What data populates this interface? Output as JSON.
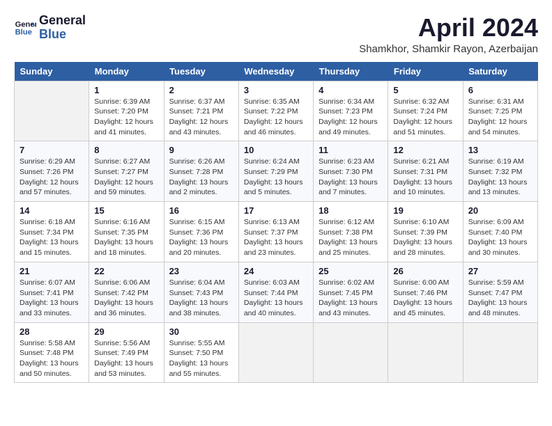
{
  "header": {
    "logo_line1": "General",
    "logo_line2": "Blue",
    "month": "April 2024",
    "location": "Shamkhor, Shamkir Rayon, Azerbaijan"
  },
  "weekdays": [
    "Sunday",
    "Monday",
    "Tuesday",
    "Wednesday",
    "Thursday",
    "Friday",
    "Saturday"
  ],
  "weeks": [
    [
      {
        "day": null
      },
      {
        "day": "1",
        "sunrise": "6:39 AM",
        "sunset": "7:20 PM",
        "daylight": "12 hours and 41 minutes."
      },
      {
        "day": "2",
        "sunrise": "6:37 AM",
        "sunset": "7:21 PM",
        "daylight": "12 hours and 43 minutes."
      },
      {
        "day": "3",
        "sunrise": "6:35 AM",
        "sunset": "7:22 PM",
        "daylight": "12 hours and 46 minutes."
      },
      {
        "day": "4",
        "sunrise": "6:34 AM",
        "sunset": "7:23 PM",
        "daylight": "12 hours and 49 minutes."
      },
      {
        "day": "5",
        "sunrise": "6:32 AM",
        "sunset": "7:24 PM",
        "daylight": "12 hours and 51 minutes."
      },
      {
        "day": "6",
        "sunrise": "6:31 AM",
        "sunset": "7:25 PM",
        "daylight": "12 hours and 54 minutes."
      }
    ],
    [
      {
        "day": "7",
        "sunrise": "6:29 AM",
        "sunset": "7:26 PM",
        "daylight": "12 hours and 57 minutes."
      },
      {
        "day": "8",
        "sunrise": "6:27 AM",
        "sunset": "7:27 PM",
        "daylight": "12 hours and 59 minutes."
      },
      {
        "day": "9",
        "sunrise": "6:26 AM",
        "sunset": "7:28 PM",
        "daylight": "13 hours and 2 minutes."
      },
      {
        "day": "10",
        "sunrise": "6:24 AM",
        "sunset": "7:29 PM",
        "daylight": "13 hours and 5 minutes."
      },
      {
        "day": "11",
        "sunrise": "6:23 AM",
        "sunset": "7:30 PM",
        "daylight": "13 hours and 7 minutes."
      },
      {
        "day": "12",
        "sunrise": "6:21 AM",
        "sunset": "7:31 PM",
        "daylight": "13 hours and 10 minutes."
      },
      {
        "day": "13",
        "sunrise": "6:19 AM",
        "sunset": "7:32 PM",
        "daylight": "13 hours and 13 minutes."
      }
    ],
    [
      {
        "day": "14",
        "sunrise": "6:18 AM",
        "sunset": "7:34 PM",
        "daylight": "13 hours and 15 minutes."
      },
      {
        "day": "15",
        "sunrise": "6:16 AM",
        "sunset": "7:35 PM",
        "daylight": "13 hours and 18 minutes."
      },
      {
        "day": "16",
        "sunrise": "6:15 AM",
        "sunset": "7:36 PM",
        "daylight": "13 hours and 20 minutes."
      },
      {
        "day": "17",
        "sunrise": "6:13 AM",
        "sunset": "7:37 PM",
        "daylight": "13 hours and 23 minutes."
      },
      {
        "day": "18",
        "sunrise": "6:12 AM",
        "sunset": "7:38 PM",
        "daylight": "13 hours and 25 minutes."
      },
      {
        "day": "19",
        "sunrise": "6:10 AM",
        "sunset": "7:39 PM",
        "daylight": "13 hours and 28 minutes."
      },
      {
        "day": "20",
        "sunrise": "6:09 AM",
        "sunset": "7:40 PM",
        "daylight": "13 hours and 30 minutes."
      }
    ],
    [
      {
        "day": "21",
        "sunrise": "6:07 AM",
        "sunset": "7:41 PM",
        "daylight": "13 hours and 33 minutes."
      },
      {
        "day": "22",
        "sunrise": "6:06 AM",
        "sunset": "7:42 PM",
        "daylight": "13 hours and 36 minutes."
      },
      {
        "day": "23",
        "sunrise": "6:04 AM",
        "sunset": "7:43 PM",
        "daylight": "13 hours and 38 minutes."
      },
      {
        "day": "24",
        "sunrise": "6:03 AM",
        "sunset": "7:44 PM",
        "daylight": "13 hours and 40 minutes."
      },
      {
        "day": "25",
        "sunrise": "6:02 AM",
        "sunset": "7:45 PM",
        "daylight": "13 hours and 43 minutes."
      },
      {
        "day": "26",
        "sunrise": "6:00 AM",
        "sunset": "7:46 PM",
        "daylight": "13 hours and 45 minutes."
      },
      {
        "day": "27",
        "sunrise": "5:59 AM",
        "sunset": "7:47 PM",
        "daylight": "13 hours and 48 minutes."
      }
    ],
    [
      {
        "day": "28",
        "sunrise": "5:58 AM",
        "sunset": "7:48 PM",
        "daylight": "13 hours and 50 minutes."
      },
      {
        "day": "29",
        "sunrise": "5:56 AM",
        "sunset": "7:49 PM",
        "daylight": "13 hours and 53 minutes."
      },
      {
        "day": "30",
        "sunrise": "5:55 AM",
        "sunset": "7:50 PM",
        "daylight": "13 hours and 55 minutes."
      },
      {
        "day": null
      },
      {
        "day": null
      },
      {
        "day": null
      },
      {
        "day": null
      }
    ]
  ],
  "labels": {
    "sunrise": "Sunrise:",
    "sunset": "Sunset:",
    "daylight": "Daylight:"
  }
}
